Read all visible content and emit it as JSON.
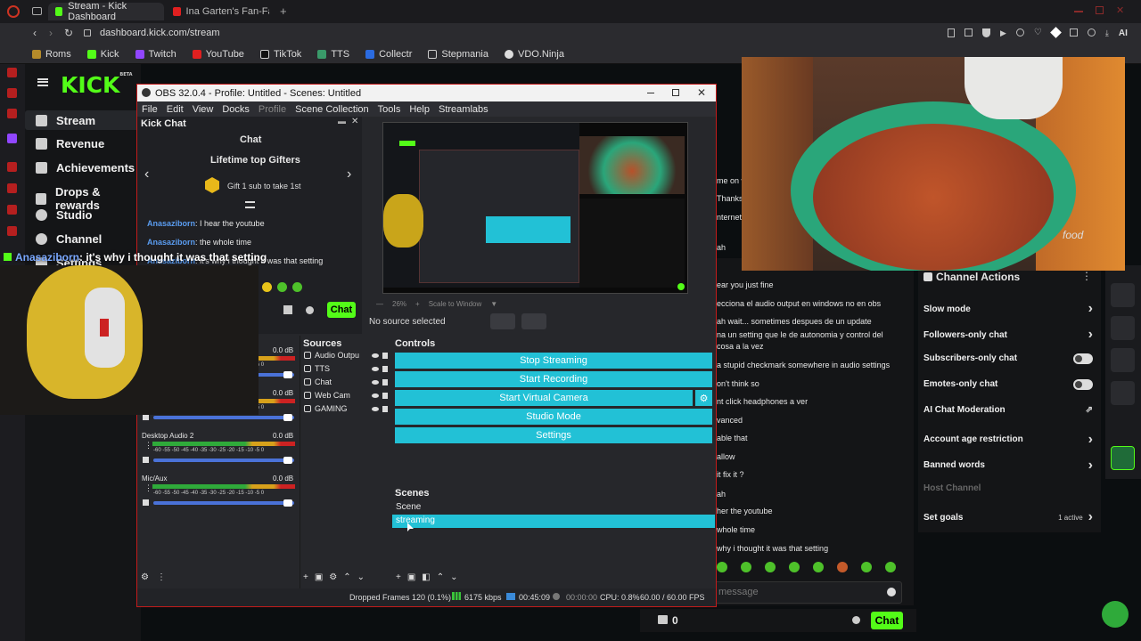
{
  "browser": {
    "tabs": [
      {
        "label": "Stream - Kick Dashboard"
      },
      {
        "label": "Ina Garten's Fan-Favo"
      }
    ],
    "new_tab": "+",
    "url": "dashboard.kick.com/stream",
    "ai_label": "AI",
    "bookmarks": [
      {
        "label": "Roms"
      },
      {
        "label": "Kick"
      },
      {
        "label": "Twitch"
      },
      {
        "label": "YouTube"
      },
      {
        "label": "TikTok"
      },
      {
        "label": "TTS"
      },
      {
        "label": "Collectr"
      },
      {
        "label": "Stepmania"
      },
      {
        "label": "VDO.Ninja"
      }
    ]
  },
  "kick": {
    "logo": "KICK",
    "beta": "BETA",
    "nav": [
      {
        "label": "Stream"
      },
      {
        "label": "Revenue"
      },
      {
        "label": "Achievements"
      },
      {
        "label": "Drops & rewards"
      },
      {
        "label": "Studio"
      },
      {
        "label": "Channel"
      },
      {
        "label": "Settings"
      }
    ],
    "chat_lines": [
      "me on w",
      "Thanks",
      "nternet",
      "ah",
      "ear you just fine",
      "ecciona el audio output en windows no en obs",
      "ah wait... sometimes despues de un update",
      "na un setting que le de autonomia y control del",
      "cosa a la vez",
      "a stupid checkmark somewhere in audio settings",
      "on't think so",
      "nt click headphones a ver",
      "vanced",
      "able that",
      "allow",
      "it fix it ?",
      "ah",
      "her the youtube",
      "whole time",
      "why i thought it was that setting"
    ],
    "send_placeholder": "message",
    "gift_count": "0",
    "chat_button": "Chat",
    "channel_actions": {
      "title": "Channel Actions",
      "items": [
        {
          "label": "Slow mode",
          "control": "chevron"
        },
        {
          "label": "Followers-only chat",
          "control": "chevron"
        },
        {
          "label": "Subscribers-only chat",
          "control": "toggle"
        },
        {
          "label": "Emotes-only chat",
          "control": "toggle"
        },
        {
          "label": "AI Chat Moderation",
          "control": "external"
        },
        {
          "label": "Account age restriction",
          "control": "chevron"
        },
        {
          "label": "Banned words",
          "control": "chevron"
        },
        {
          "label": "Host Channel",
          "control": "disabled"
        },
        {
          "label": "Set goals",
          "control": "chevron",
          "badge": "1 active"
        }
      ]
    }
  },
  "obs": {
    "title": "OBS 32.0.4 - Profile: Untitled - Scenes: Untitled",
    "menu": [
      "File",
      "Edit",
      "View",
      "Docks",
      "Profile",
      "Scene Collection",
      "Tools",
      "Help",
      "Streamlabs"
    ],
    "chat_dock": {
      "title": "Kick Chat",
      "header": "Chat",
      "gifters_title": "Lifetime top Gifters",
      "gifters_hint": "Gift 1 sub to take 1st",
      "messages": [
        {
          "user": "Anasaziborn",
          "text": ": I hear the youtube"
        },
        {
          "user": "Anasaziborn",
          "text": ": the whole time"
        },
        {
          "user": "Anasaziborn",
          "text": ": it's why i thought it was that setting"
        }
      ],
      "chat_button": "Chat"
    },
    "zoom": "26%",
    "scale_label": "Scale to Window",
    "no_source": "No source selected",
    "sources": {
      "title": "Sources",
      "items": [
        {
          "label": "Audio Outpu"
        },
        {
          "label": "TTS"
        },
        {
          "label": "Chat"
        },
        {
          "label": "Web Cam"
        },
        {
          "label": "GAMING"
        }
      ]
    },
    "controls": {
      "title": "Controls",
      "buttons": [
        "Stop Streaming",
        "Start Recording",
        "Start Virtual Camera",
        "Studio Mode",
        "Settings"
      ]
    },
    "scenes": {
      "title": "Scenes",
      "items": [
        {
          "label": "Scene"
        },
        {
          "label": "streaming"
        }
      ]
    },
    "mixer": [
      {
        "name": "",
        "db": "0.0 dB"
      },
      {
        "name": "",
        "db": "0.0 dB"
      },
      {
        "name": "Desktop Audio 2",
        "db": "0.0 dB"
      },
      {
        "name": "Mic/Aux",
        "db": "0.0 dB"
      }
    ],
    "meter_scale": "-60 -55 -50 -45 -40 -35 -30 -25 -20 -15 -10 -5 0",
    "status": {
      "dropped": "Dropped Frames 120 (0.1%)",
      "kbps": "6175 kbps",
      "time1": "00:45:09",
      "time2": "00:00:00",
      "cpu": "CPU: 0.8%",
      "fps": "60.00 / 60.00 FPS"
    }
  },
  "overlay": {
    "user": "Anasaziborn",
    "text": ": it's why i thought it was that setting",
    "video_logo": "food"
  },
  "colors": {
    "kick_green": "#53fc18",
    "obs_cyan": "#22c1d6",
    "accent_red": "#c31b1b"
  }
}
